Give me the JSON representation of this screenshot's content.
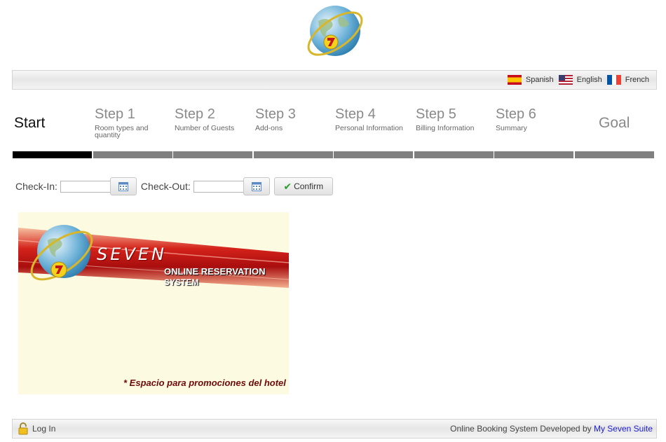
{
  "header": {
    "logo_icon": "globe-seven-logo-icon"
  },
  "languages": [
    {
      "label": "Spanish",
      "icon": "spain-flag-icon"
    },
    {
      "label": "English",
      "icon": "usa-flag-icon"
    },
    {
      "label": "French",
      "icon": "france-flag-icon"
    }
  ],
  "steps": [
    {
      "title": "Start",
      "subtitle": "",
      "active": true
    },
    {
      "title": "Step 1",
      "subtitle": "Room types and quantity"
    },
    {
      "title": "Step 2",
      "subtitle": "Number of Guests"
    },
    {
      "title": "Step 3",
      "subtitle": "Add-ons"
    },
    {
      "title": "Step 4",
      "subtitle": "Personal Information"
    },
    {
      "title": "Step 5",
      "subtitle": "Billing Information"
    },
    {
      "title": "Step 6",
      "subtitle": "Summary"
    },
    {
      "title": "Goal",
      "subtitle": ""
    }
  ],
  "booking": {
    "checkin_label": "Check-In:",
    "checkin_value": "",
    "checkout_label": "Check-Out:",
    "checkout_value": "",
    "confirm_label": "Confirm"
  },
  "promo": {
    "brand": "SEVEN",
    "line1": "ONLINE RESERVATION",
    "line2": "SYSTEM",
    "note": "* Espacio para  promociones del hotel"
  },
  "footer": {
    "login_label": "Log In",
    "credit_text": "Online Booking System Developed by ",
    "credit_link": "My Seven Suite"
  },
  "colors": {
    "active_step": "#000000",
    "inactive_step": "#808080",
    "link": "#1a1ad6",
    "confirm_check": "#2e9e2e"
  }
}
